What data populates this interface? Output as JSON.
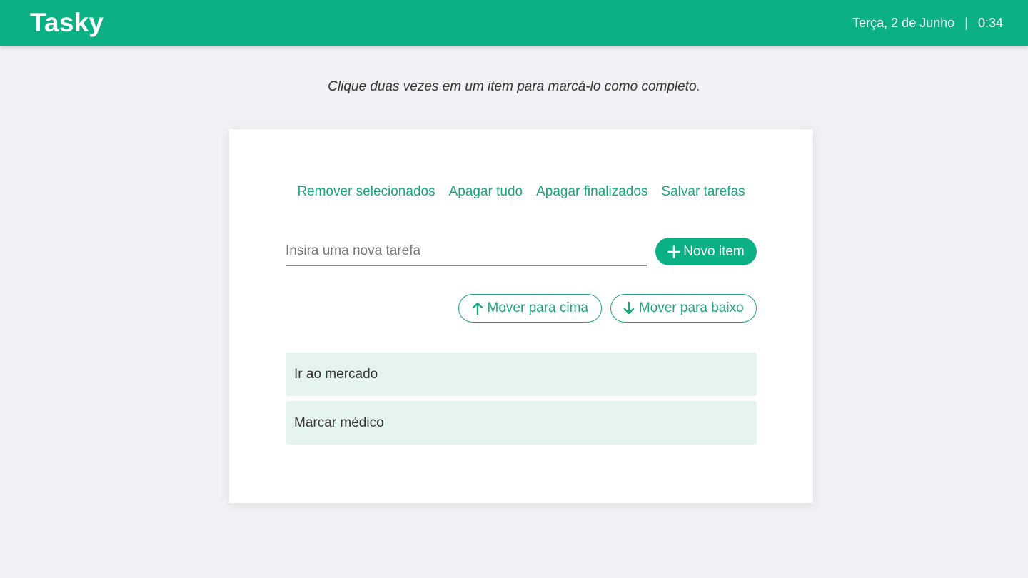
{
  "header": {
    "brand": "Tasky",
    "date": "Terça, 2 de Junho",
    "separator": "|",
    "time": "0:34"
  },
  "hint": "Clique duas vezes em um item para marcá-lo como completo.",
  "actions": {
    "remove_selected": "Remover selecionados",
    "clear_all": "Apagar tudo",
    "clear_finished": "Apagar finalizados",
    "save_tasks": "Salvar tarefas"
  },
  "input": {
    "placeholder": "Insira uma nova tarefa",
    "value": ""
  },
  "buttons": {
    "new_item": "Novo item",
    "move_up": "Mover para cima",
    "move_down": "Mover para baixo"
  },
  "tasks": [
    {
      "label": "Ir ao mercado"
    },
    {
      "label": "Marcar médico"
    }
  ],
  "colors": {
    "accent": "#0bb085",
    "link": "#1aa57e",
    "item_bg": "#e5f5ee",
    "page_bg": "#eff1f4"
  },
  "icons": {
    "new_item": "plus-icon",
    "move_up": "arrow-up-icon",
    "move_down": "arrow-down-icon"
  }
}
